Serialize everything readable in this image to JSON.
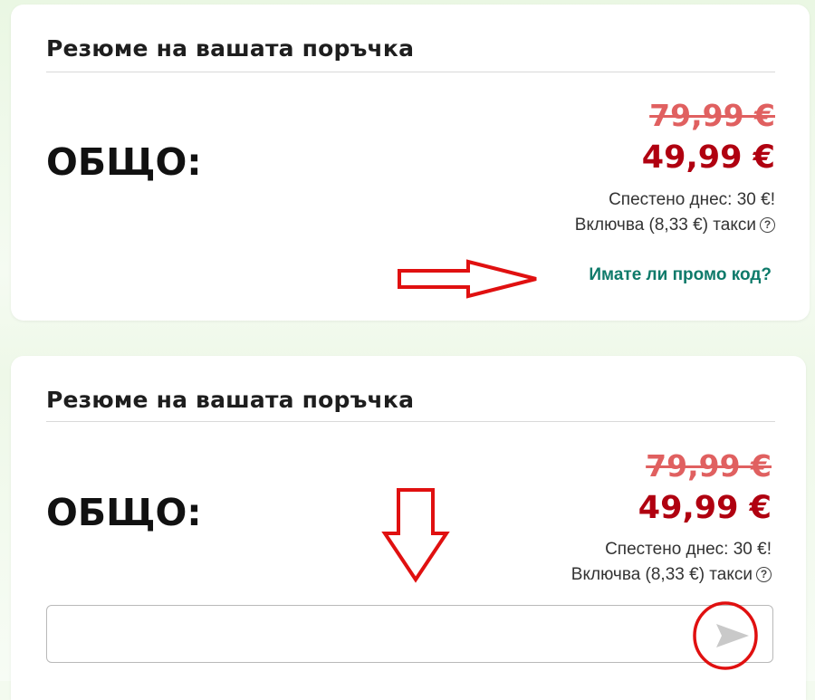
{
  "cards": [
    {
      "title": "Резюме на вашата поръчка",
      "total_label": "ОБЩО:",
      "old_price": "79,99 €",
      "new_price": "49,99 €",
      "saved_text": "Спестено днес: 30 €!",
      "tax_text": "Включва (8,33 €) такси",
      "promo_link": "Имате ли промо код?"
    },
    {
      "title": "Резюме на вашата поръчка",
      "total_label": "ОБЩО:",
      "old_price": "79,99 €",
      "new_price": "49,99 €",
      "saved_text": "Спестено днес: 30 €!",
      "tax_text": "Включва (8,33 €) такси",
      "promo_input": {
        "value": "",
        "placeholder": ""
      }
    }
  ],
  "icons": {
    "help": "question-circle-icon",
    "send": "send-arrow-icon"
  },
  "annotations": {
    "color": "#e01010",
    "items": [
      "right-arrow",
      "down-arrow",
      "circle"
    ]
  },
  "colors": {
    "old_price": "#e06060",
    "new_price": "#b00010",
    "promo_link": "#0e7a6a"
  }
}
